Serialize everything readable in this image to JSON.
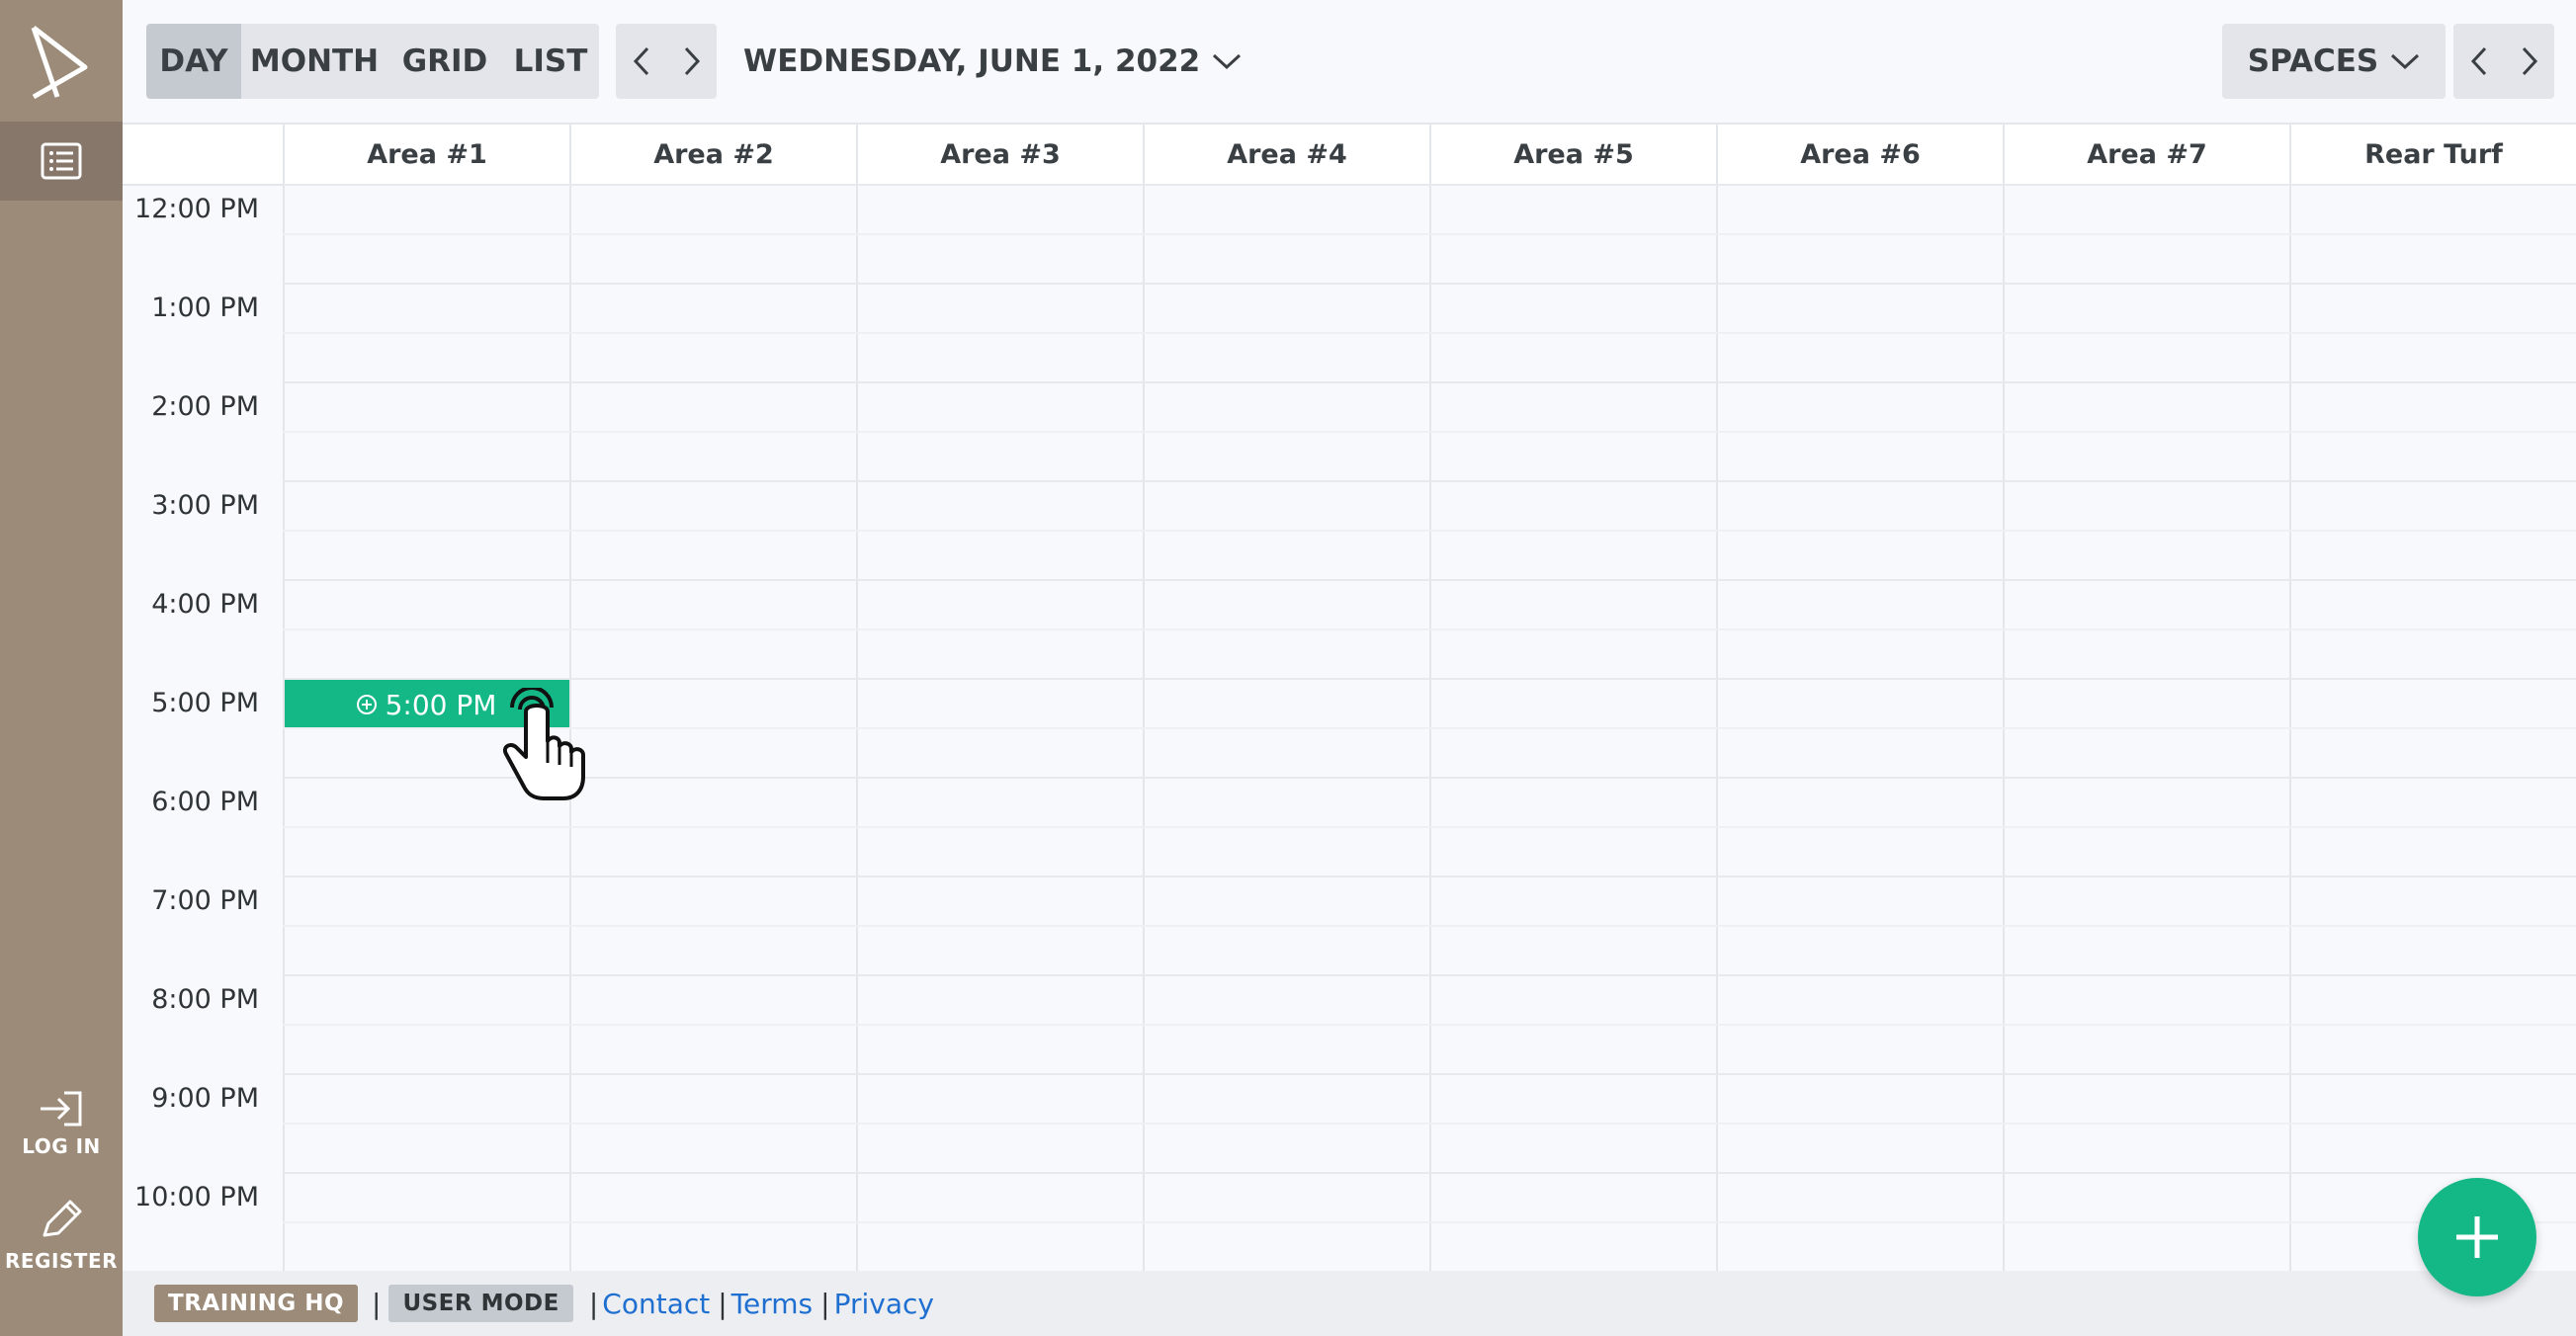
{
  "sidebar": {
    "login_label": "LOG IN",
    "register_label": "REGISTER"
  },
  "toolbar": {
    "views": [
      "DAY",
      "MONTH",
      "GRID",
      "LIST"
    ],
    "active_view": "DAY",
    "date_title": "WEDNESDAY, JUNE 1, 2022",
    "spaces_label": "SPACES"
  },
  "columns": [
    "Area #1",
    "Area #2",
    "Area #3",
    "Area #4",
    "Area #5",
    "Area #6",
    "Area #7",
    "Rear Turf"
  ],
  "times": [
    "12:00 PM",
    "1:00 PM",
    "2:00 PM",
    "3:00 PM",
    "4:00 PM",
    "5:00 PM",
    "6:00 PM",
    "7:00 PM",
    "8:00 PM",
    "9:00 PM",
    "10:00 PM"
  ],
  "selected_slot": {
    "label": "5:00 PM",
    "column": "Area #1"
  },
  "footer": {
    "org_badge": "TRAINING HQ",
    "mode_badge": "USER MODE",
    "links": [
      "Contact",
      "Terms",
      "Privacy"
    ]
  },
  "colors": {
    "sidebar": "#9b8b78",
    "accent_green": "#14b886",
    "link_blue": "#1f6fd1"
  }
}
